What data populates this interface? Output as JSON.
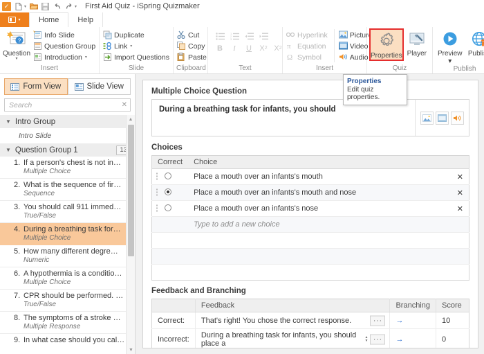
{
  "titlebar": {
    "app_title": "First Aid Quiz - iSpring Quizmaker",
    "qat": [
      "new-icon",
      "open-icon",
      "save-icon",
      "undo-icon",
      "redo-icon",
      "customize-qat-icon"
    ]
  },
  "tabs": {
    "file_label": "",
    "items": [
      {
        "label": "Home",
        "active": true
      },
      {
        "label": "Help",
        "active": false
      }
    ]
  },
  "ribbon": {
    "groups": [
      {
        "title": "Insert",
        "big_button": {
          "label": "Question",
          "icon": "question-icon"
        },
        "items": [
          {
            "label": "Info Slide",
            "icon": "info-slide-icon",
            "dropdown": false
          },
          {
            "label": "Question Group",
            "icon": "question-group-icon",
            "dropdown": false
          },
          {
            "label": "Introduction",
            "icon": "introduction-icon",
            "dropdown": true
          }
        ]
      },
      {
        "title": "Slide",
        "items": [
          {
            "label": "Duplicate",
            "icon": "duplicate-icon",
            "dropdown": false
          },
          {
            "label": "Link",
            "icon": "link-icon",
            "dropdown": true
          },
          {
            "label": "Import Questions",
            "icon": "import-questions-icon",
            "dropdown": false
          }
        ]
      },
      {
        "title": "Clipboard",
        "items": [
          {
            "label": "Cut",
            "icon": "cut-icon"
          },
          {
            "label": "Copy",
            "icon": "copy-icon"
          },
          {
            "label": "Paste",
            "icon": "paste-icon"
          }
        ]
      },
      {
        "title": "Text",
        "row1": [
          "bullet-list-icon",
          "numbered-list-icon",
          "decrease-indent-icon",
          "increase-indent-icon"
        ],
        "row2": [
          "bold-icon",
          "italic-icon",
          "underline-icon",
          "subscript-icon",
          "superscript-icon"
        ],
        "row2_labels": [
          "B",
          "I",
          "U",
          "X",
          "X"
        ]
      },
      {
        "title": "Insert",
        "col1": [
          {
            "label": "Hyperlink",
            "icon": "hyperlink-icon",
            "disabled": true
          },
          {
            "label": "Equation",
            "icon": "equation-icon",
            "disabled": true
          },
          {
            "label": "Symbol",
            "icon": "symbol-icon",
            "disabled": true
          }
        ],
        "col2": [
          {
            "label": "Picture",
            "icon": "picture-icon",
            "dropdown": false
          },
          {
            "label": "Video",
            "icon": "video-icon",
            "dropdown": false
          },
          {
            "label": "Audio",
            "icon": "audio-icon",
            "dropdown": true
          }
        ]
      },
      {
        "title": "Quiz",
        "items": [
          {
            "label": "Properties",
            "icon": "gear-icon",
            "selected": true
          },
          {
            "label": "Player",
            "icon": "player-icon",
            "selected": false
          }
        ]
      },
      {
        "title": "Publish",
        "items": [
          {
            "label": "Preview",
            "icon": "preview-icon",
            "dropdown": true
          },
          {
            "label": "Publish",
            "icon": "publish-icon",
            "dropdown": false
          }
        ]
      }
    ]
  },
  "tooltip": {
    "title": "Properties",
    "body": "Edit quiz properties."
  },
  "sidebar": {
    "view_toggle": [
      {
        "label": "Form View",
        "active": true,
        "icon": "form-view-icon"
      },
      {
        "label": "Slide View",
        "active": false,
        "icon": "slide-view-icon"
      }
    ],
    "search": {
      "value": "",
      "placeholder": "Search",
      "clear_icon": "clear-icon"
    },
    "intro_group": {
      "label": "Intro Group",
      "expanded": true
    },
    "intro_slide": {
      "label": "Intro Slide"
    },
    "question_group": {
      "label": "Question Group 1",
      "count": "13",
      "expanded": true
    },
    "questions": [
      {
        "num": "1.",
        "text": "If a person's chest is not in…",
        "type": "Multiple Choice",
        "selected": false
      },
      {
        "num": "2.",
        "text": "What is the sequence of fir…",
        "type": "Sequence",
        "selected": false
      },
      {
        "num": "3.",
        "text": "You should call 911 immed…",
        "type": "True/False",
        "selected": false
      },
      {
        "num": "4.",
        "text": "During a breathing task for…",
        "type": "Multiple Choice",
        "selected": true
      },
      {
        "num": "5.",
        "text": "How many different degre…",
        "type": "Numeric",
        "selected": false
      },
      {
        "num": "6.",
        "text": "A hypothermia is a conditio…",
        "type": "Multiple Choice",
        "selected": false
      },
      {
        "num": "7.",
        "text": "CPR should be performed. …",
        "type": "True/False",
        "selected": false
      },
      {
        "num": "8.",
        "text": "The symptoms of a stroke …",
        "type": "Multiple Response",
        "selected": false
      },
      {
        "num": "9.",
        "text": "In what case should you cal…",
        "type": "",
        "selected": false
      }
    ]
  },
  "editor": {
    "question_type_title": "Multiple Choice Question",
    "question_text": "During a breathing task for infants, you should",
    "media_buttons": [
      "insert-picture-icon",
      "insert-video-icon",
      "insert-audio-icon"
    ],
    "choices_title": "Choices",
    "choices_headers": {
      "correct": "Correct",
      "choice": "Choice"
    },
    "choices": [
      {
        "correct": false,
        "text": "Place a mouth over an infants's mouth"
      },
      {
        "correct": true,
        "text": "Place a mouth over an infants's mouth and nose"
      },
      {
        "correct": false,
        "text": "Place a mouth over an infants's nose"
      }
    ],
    "add_choice_placeholder": "Type to add a new choice",
    "feedback_title": "Feedback and Branching",
    "feedback_headers": {
      "blank": "",
      "feedback": "Feedback",
      "branching": "Branching",
      "score": "Score"
    },
    "feedback_rows": [
      {
        "label": "Correct:",
        "text": "That's right! You chose the correct response.",
        "more": "…",
        "branching": "→",
        "score": "10",
        "spinner": false
      },
      {
        "label": "Incorrect:",
        "text": "During a breathing task for infants, you should place a",
        "more": "…",
        "branching": "→",
        "score": "0",
        "spinner": true
      }
    ]
  },
  "colors": {
    "accent_orange": "#ee7f1c",
    "selection_orange": "#f9c89a",
    "highlight_border": "#e52d2d",
    "link_blue": "#2f6fd0"
  }
}
